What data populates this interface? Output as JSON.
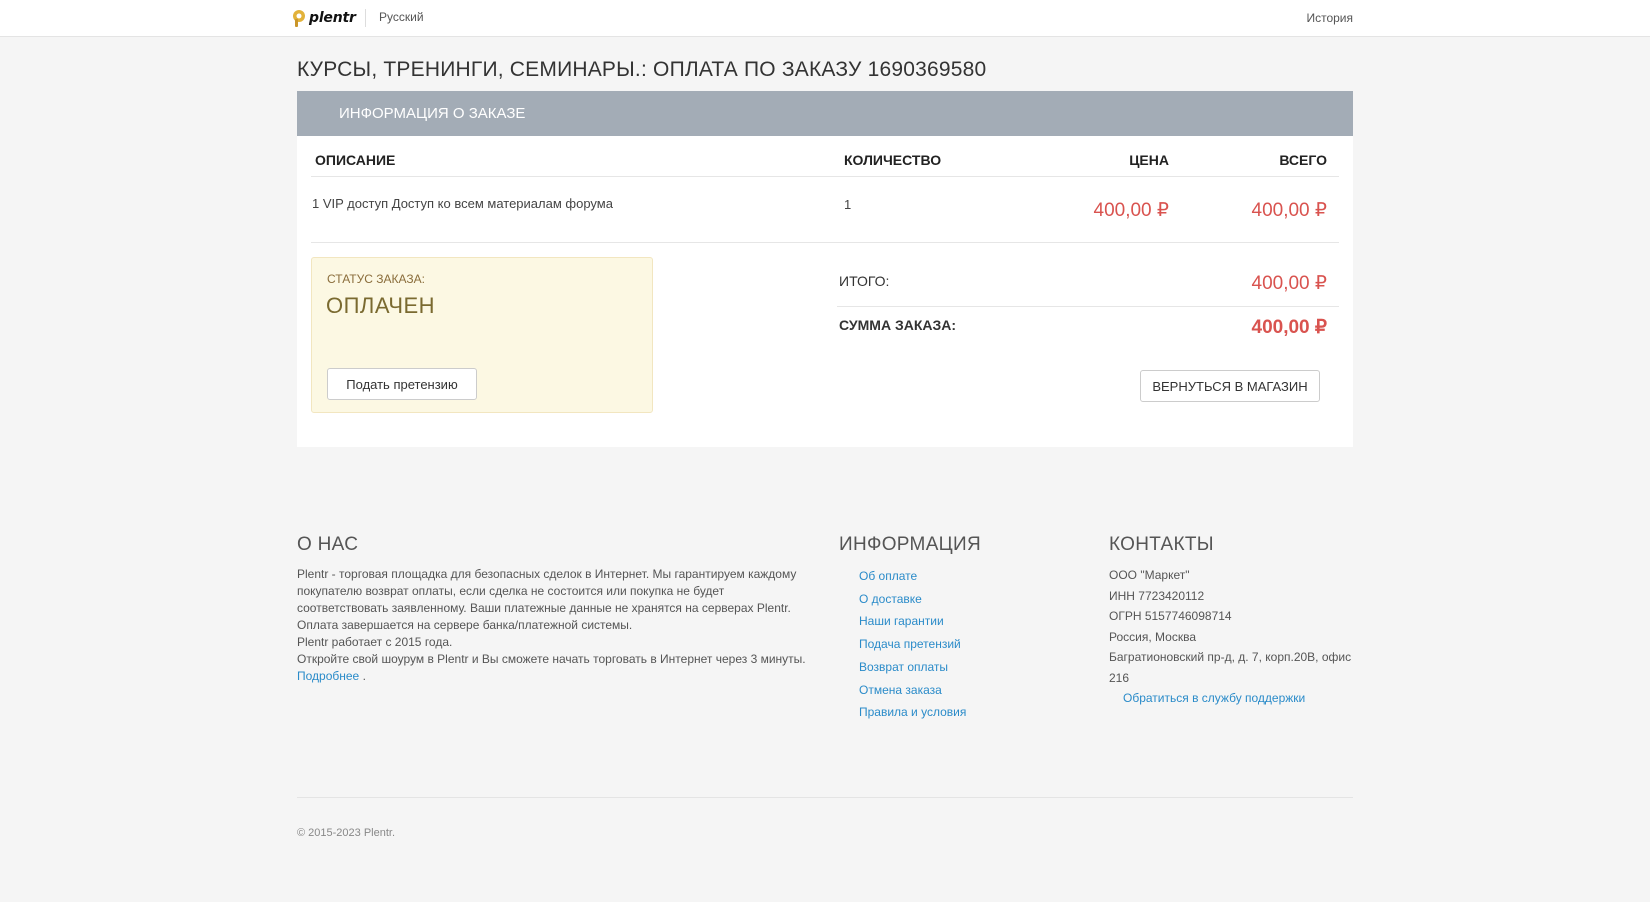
{
  "header": {
    "logo_text": "plentr",
    "language": "Русский",
    "history_link": "История"
  },
  "page": {
    "title": "КУРСЫ, ТРЕНИНГИ, СЕМИНАРЫ.: ОПЛАТА ПО ЗАКАЗУ 1690369580"
  },
  "order": {
    "panel_title": "ИНФОРМАЦИЯ О ЗАКАЗЕ",
    "columns": {
      "description": "ОПИСАНИЕ",
      "quantity": "КОЛИЧЕСТВО",
      "price": "ЦЕНА",
      "total": "ВСЕГО"
    },
    "items": [
      {
        "description": "1 VIP доступ Доступ ко всем материалам форума",
        "quantity": "1",
        "price": "400,00 ₽",
        "total": "400,00 ₽"
      }
    ],
    "status_label": "СТАТУС ЗАКАЗА:",
    "status_value": "ОПЛАЧЕН",
    "claim_button": "Подать претензию",
    "subtotal_label": "ИТОГО:",
    "subtotal_value": "400,00 ₽",
    "grand_total_label": "СУММА ЗАКАЗА:",
    "grand_total_value": "400,00 ₽",
    "return_button": "ВЕРНУТЬСЯ В МАГАЗИН"
  },
  "footer": {
    "about": {
      "title": "О НАС",
      "text1": "Plentr - торговая площадка для безопасных сделок в Интернет. Мы гарантируем каждому покупателю возврат оплаты, если сделка не состоится или покупка не будет соответствовать заявленному. Ваши платежные данные не хранятся на серверах Plentr. Оплата завершается на сервере банка/платежной системы.",
      "text2": "Plentr работает с 2015 года.",
      "text3": "Откройте свой шоурум в Plentr и Вы сможете начать торговать в Интернет через 3 минуты.",
      "more_link": "Подробнее",
      "more_suffix": " ."
    },
    "info": {
      "title": "ИНФОРМАЦИЯ",
      "links": [
        "Об оплате",
        "О доставке",
        "Наши гарантии",
        "Подача претензий",
        "Возврат оплаты",
        "Отмена заказа",
        "Правила и условия"
      ]
    },
    "contacts": {
      "title": "КОНТАКТЫ",
      "company": "ООО \"Маркет\"",
      "inn": "ИНН 7723420112",
      "ogrn": "ОГРН 5157746098714",
      "city": "Россия, Москва",
      "address": "Багратионовский пр-д, д. 7, корп.20В, офис 216",
      "support_link": "Обратиться в службу поддержки"
    },
    "copyright": "© 2015-2023 Plentr."
  },
  "colors": {
    "price": "#d9534f",
    "panel_header": "#a3acb6",
    "status_bg": "#fcf8e3",
    "link": "#2a8bc9"
  },
  "icons": {
    "logo": "plentr-logo-icon"
  }
}
